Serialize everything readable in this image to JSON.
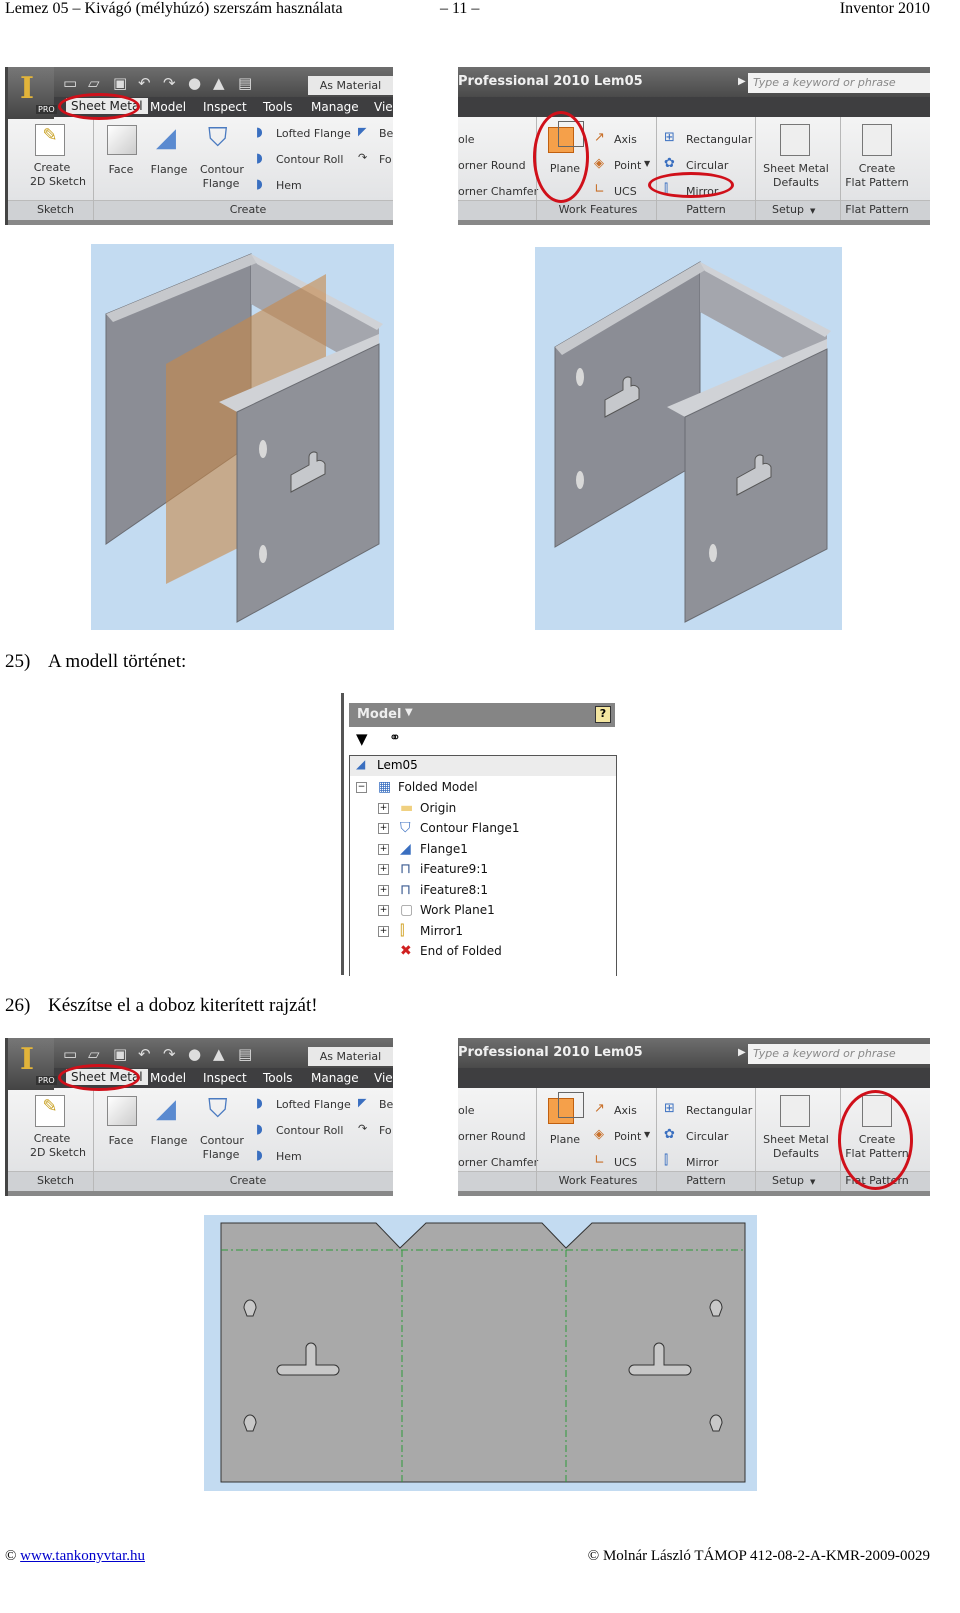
{
  "header": {
    "left": "Lemez 05 – Kivágó (mélyhúzó) szerszám használata",
    "center": "– 11 –",
    "right": "Inventor 2010"
  },
  "ribbon_left": {
    "app_badge": "PRO",
    "appearance": "As Material",
    "tabs": [
      "Sheet Metal",
      "Model",
      "Inspect",
      "Tools",
      "Manage",
      "View"
    ],
    "create_sketch": [
      "Create",
      "2D Sketch"
    ],
    "face": "Face",
    "flange": "Flange",
    "contour_flange": [
      "Contour",
      "Flange"
    ],
    "lofted_flange": "Lofted Flange",
    "contour_roll": "Contour Roll",
    "hem": "Hem",
    "bend": "Be",
    "fold": "Fo",
    "panel_sketch": "Sketch",
    "panel_create": "Create"
  },
  "ribbon_right": {
    "title": "Professional 2010    Lem05",
    "search_placeholder": "Type a keyword or phrase",
    "cut_items": [
      "ole",
      "orner Round",
      "orner Chamfer"
    ],
    "plane": "Plane",
    "axis": "Axis",
    "point": "Point",
    "ucs": "UCS",
    "rectangular": "Rectangular",
    "circular": "Circular",
    "mirror": "Mirror",
    "sheet_metal_defaults": [
      "Sheet Metal",
      "Defaults"
    ],
    "create_flat_pattern": [
      "Create",
      "Flat Pattern"
    ],
    "panel_work_features": "Work Features",
    "panel_pattern": "Pattern",
    "panel_setup": "Setup",
    "panel_flat_pattern": "Flat Pattern"
  },
  "step25": {
    "number": "25)",
    "text": "A modell történet:"
  },
  "model_browser": {
    "title": "Model",
    "root": "Lem05",
    "items": [
      {
        "label": "Folded Model",
        "icon": "folded-model-icon"
      },
      {
        "label": "Origin",
        "icon": "folder-icon"
      },
      {
        "label": "Contour Flange1",
        "icon": "contour-flange-icon"
      },
      {
        "label": "Flange1",
        "icon": "flange-icon"
      },
      {
        "label": "iFeature9:1",
        "icon": "ifeature-icon"
      },
      {
        "label": "iFeature8:1",
        "icon": "ifeature-icon"
      },
      {
        "label": "Work Plane1",
        "icon": "work-plane-icon"
      },
      {
        "label": "Mirror1",
        "icon": "mirror-icon"
      },
      {
        "label": "End of Folded",
        "icon": "end-of-folded-icon"
      }
    ]
  },
  "step26": {
    "number": "26)",
    "text": "Készítse el a doboz kiterített rajzát!"
  },
  "colors": {
    "highlight": "#d0101a",
    "sheet": "#8b8d95",
    "background": "#c3dbf1",
    "plane": "#c8884a",
    "fold_line": "#2e9a3a"
  },
  "footer": {
    "left_prefix": "© ",
    "link": "www.tankonyvtar.hu",
    "right": "© Molnár László TÁMOP 412-08-2-A-KMR-2009-0029"
  }
}
